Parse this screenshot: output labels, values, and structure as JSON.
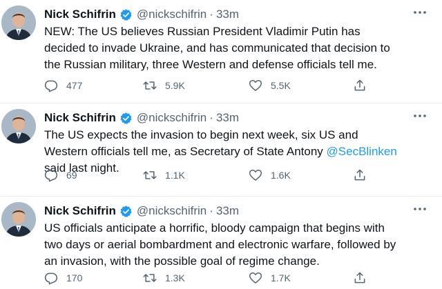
{
  "tweets": [
    {
      "name": "Nick Schifrin",
      "handle": "@nickschifrin",
      "separator": "·",
      "time": "33m",
      "text": "NEW: The US believes Russian President Vladimir Putin has decided to invade Ukraine, and has communicated that decision to the Russian military, three Western and defense officials tell me.",
      "replies": "477",
      "retweets": "5.9K",
      "likes": "5.5K"
    },
    {
      "name": "Nick Schifrin",
      "handle": "@nickschifrin",
      "separator": "·",
      "time": "33m",
      "text_before": "The US expects the invasion to begin next week, six US and Western officials tell me, as Secretary of State Antony ",
      "mention": "@SecBlinken",
      "text_after": " said last night.",
      "replies": "69",
      "retweets": "1.1K",
      "likes": "1.6K"
    },
    {
      "name": "Nick Schifrin",
      "handle": "@nickschifrin",
      "separator": "·",
      "time": "33m",
      "text": "US officials anticipate a horrific, bloody campaign that begins with two days or aerial bombardment and electronic warfare, followed by an invasion, with the possible goal of regime change.",
      "replies": "170",
      "retweets": "1.3K",
      "likes": "1.7K"
    }
  ],
  "icons": {
    "verified": "verified-badge-icon",
    "more": "more-options-icon",
    "reply": "reply-icon",
    "retweet": "retweet-icon",
    "like": "like-icon",
    "share": "share-icon"
  },
  "colors": {
    "text": "#0f1419",
    "secondary": "#536471",
    "accent": "#1d9bf0",
    "divider": "#e6ecf0"
  }
}
